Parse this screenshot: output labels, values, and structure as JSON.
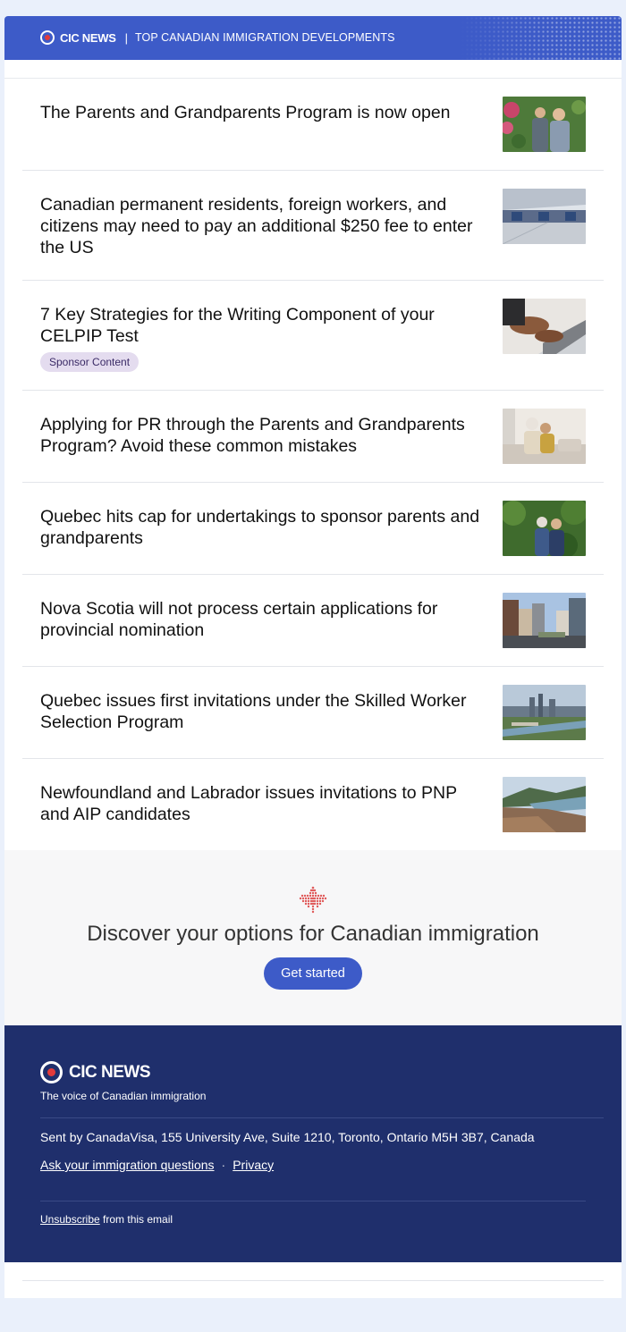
{
  "header": {
    "brand": "CIC NEWS",
    "separator": "|",
    "tagline": "TOP CANADIAN IMMIGRATION DEVELOPMENTS"
  },
  "articles": [
    {
      "title": "The Parents and Grandparents Program is now open"
    },
    {
      "title": "Canadian permanent residents, foreign workers, and citizens may need to pay an additional $250 fee to enter the US"
    },
    {
      "title": "7 Key Strategies for the Writing Component of your CELPIP Test",
      "badge": "Sponsor Content"
    },
    {
      "title": "Applying for PR through the Parents and Grandparents Program? Avoid these common mistakes"
    },
    {
      "title": "Quebec hits cap for undertakings to sponsor parents and grandparents"
    },
    {
      "title": "Nova Scotia will not process certain applications for provincial nomination"
    },
    {
      "title": "Quebec issues first invitations under the Skilled Worker Selection Program"
    },
    {
      "title": "Newfoundland and Labrador issues invitations to PNP and AIP candidates"
    }
  ],
  "discover": {
    "heading": "Discover your options for Canadian immigration",
    "button": "Get started"
  },
  "footer": {
    "brand": "CIC NEWS",
    "tagline": "The voice of Canadian immigration",
    "address": "Sent by CanadaVisa, 155 University Ave, Suite 1210, Toronto, Ontario M5H 3B7, Canada",
    "link_questions": "Ask your immigration questions",
    "link_separator": "·",
    "link_privacy": "Privacy",
    "unsubscribe": "Unsubscribe",
    "unsubscribe_suffix": " from this email"
  },
  "colors": {
    "header_blue": "#3d5bc8",
    "footer_navy": "#1f2f6c",
    "badge_bg": "#e4dcef",
    "maple_red": "#e05a5a"
  },
  "icons": {
    "logo": "cic-news-logo-icon",
    "discover": "maple-leaf-icon"
  }
}
